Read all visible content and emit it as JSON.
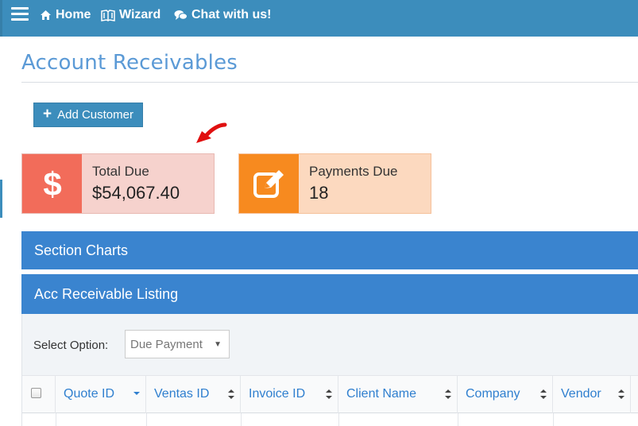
{
  "nav": {
    "home_label": "Home",
    "wizard_label": "Wizard",
    "chat_label": "Chat with us!",
    "home_icon": "home-icon",
    "wizard_icon": "book-icon",
    "chat_icon": "chat-bubbles-icon",
    "menu_icon": "hamburger-icon"
  },
  "page": {
    "title": "Account Receivables"
  },
  "toolbar": {
    "add_customer_label": "Add Customer",
    "add_icon": "plus-icon"
  },
  "info_boxes": [
    {
      "label": "Total Due",
      "value": "$54,067.40",
      "icon": "dollar-icon",
      "color": "#f26c5a"
    },
    {
      "label": "Payments Due",
      "value": "18",
      "icon": "edit-icon",
      "color": "#f78a1f"
    }
  ],
  "sections": {
    "charts_title": "Section Charts",
    "listing_title": "Acc Receivable Listing"
  },
  "filter": {
    "label": "Select Option:",
    "selected": "Due Payment"
  },
  "table": {
    "columns": [
      "Quote ID",
      "Ventas ID",
      "Invoice ID",
      "Client Name",
      "Company",
      "Vendor"
    ]
  },
  "colors": {
    "topbar": "#3c8dbc",
    "section_bar": "#3a84cf",
    "link": "#2f7fcf",
    "annotation_arrow": "#e01010"
  }
}
